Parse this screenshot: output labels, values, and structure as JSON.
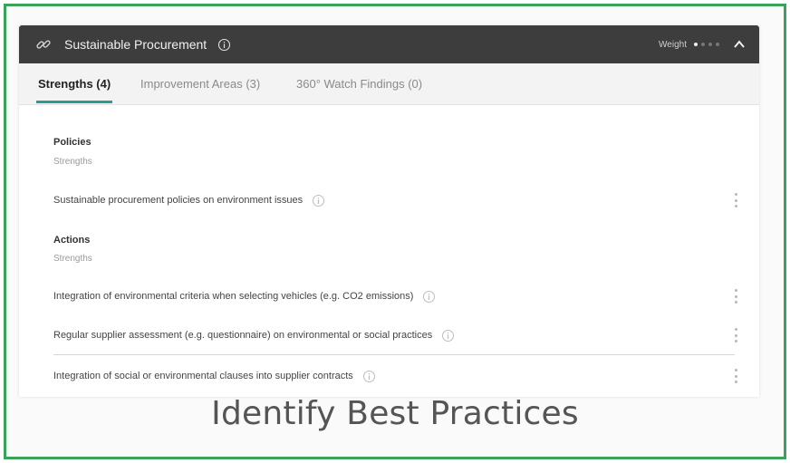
{
  "header": {
    "title": "Sustainable Procurement",
    "weight_label": "Weight",
    "weight_level": 1,
    "weight_max": 4,
    "icons": {
      "link": "link-icon",
      "info": "info-icon",
      "collapse": "chevron-up-icon"
    }
  },
  "tabs": [
    {
      "label": "Strengths (4)",
      "active": true
    },
    {
      "label": "Improvement Areas (3)",
      "active": false
    },
    {
      "label": "360° Watch Findings (0)",
      "active": false
    }
  ],
  "sections": [
    {
      "title": "Policies",
      "subtitle": "Strengths",
      "items": [
        {
          "text": "Sustainable procurement policies on environment issues"
        }
      ]
    },
    {
      "title": "Actions",
      "subtitle": "Strengths",
      "items": [
        {
          "text": "Integration of environmental criteria when selecting vehicles (e.g. CO2 emissions)"
        },
        {
          "text": "Regular supplier assessment (e.g. questionnaire) on environmental or social practices"
        },
        {
          "text": "Integration of social or environmental clauses into supplier contracts"
        }
      ]
    }
  ],
  "caption": "Identify Best Practices",
  "colors": {
    "frame_border": "#3aa35a",
    "header_bg": "#3d3d3d",
    "tab_underline": "#2a9d8f"
  }
}
